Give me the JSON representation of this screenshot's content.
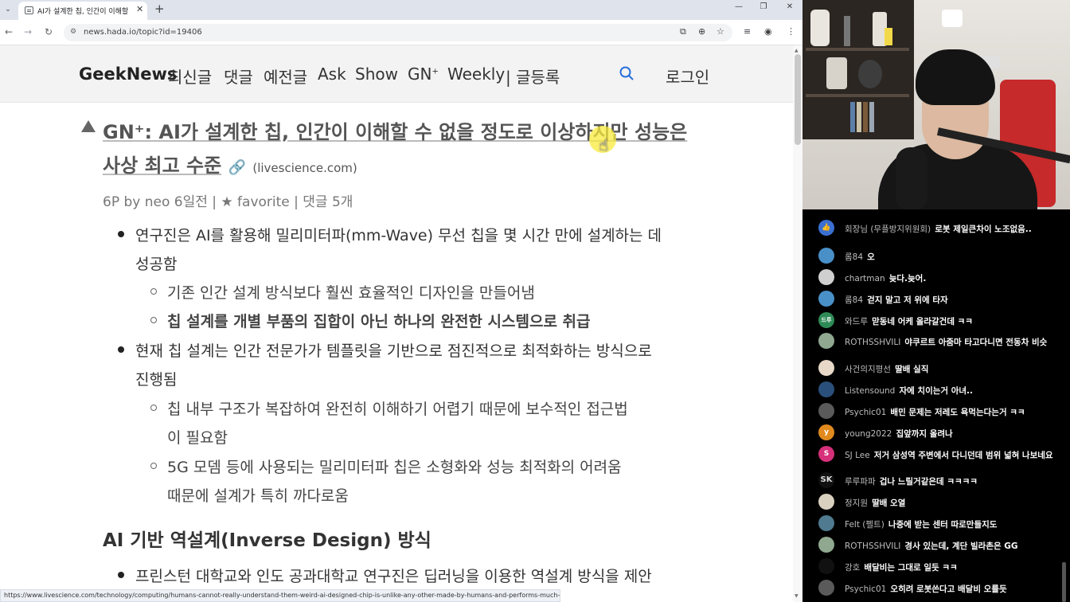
{
  "browser": {
    "tab_title": "AI가 설계한 칩, 인간이 이해할",
    "url": "news.hada.io/topic?id=19406",
    "status_url": "https://www.livescience.com/technology/computing/humans-cannot-really-understand-them-weird-ai-designed-chip-is-unlike-any-other-made-by-humans-and-performs-much-better"
  },
  "site": {
    "brand": "GeekNews",
    "nav": [
      "최신글",
      "댓글",
      "예전글",
      "Ask",
      "Show",
      "GN",
      "Weekly",
      "| 글등록"
    ],
    "nav_gn_sup": "+",
    "login": "로그인"
  },
  "article": {
    "title_line1": "GN⁺: AI가 설계한 칩, 인간이 이해할 수 없을 정도로 이상하지만 성능은",
    "title_line2": "사상 최고 수준",
    "domain": "(livescience.com)",
    "meta": "6P by neo 6일전 | ★ favorite | 댓글 5개",
    "b1_l1": "연구진은 AI를 활용해 밀리미터파(mm-Wave) 무선 칩을 몇 시간 만에 설계하는 데",
    "b1_l2": "성공함",
    "b1_s1": "기존 인간 설계 방식보다 훨씬 효율적인 디자인을 만들어냄",
    "b1_s2": "칩 설계를 개별 부품의 집합이 아닌 하나의 완전한 시스템으로 취급",
    "b2_l1": "현재 칩 설계는 인간 전문가가 템플릿을 기반으로 점진적으로 최적화하는 방식으로",
    "b2_l2": "진행됨",
    "b2_s1_l1": "칩 내부 구조가 복잡하여 완전히 이해하기 어렵기 때문에 보수적인 접근법",
    "b2_s1_l2": "이 필요함",
    "b2_s2_l1": "5G 모뎀 등에 사용되는 밀리미터파 칩은 소형화와 성능 최적화의 어려움",
    "b2_s2_l2": "때문에 설계가 특히 까다로움",
    "h2": "AI 기반 역설계(Inverse Design) 방식",
    "b3_l1": "프린스턴 대학교와 인도 공과대학교 연구진은 딥러닝을 이용한 역설계 방식을 제안"
  },
  "chat": [
    {
      "user": "회장님 (무플방지위원회)",
      "msg": "로봇 제일큰차이 노조없음..",
      "color": "#3b6fd1",
      "avatar": "👍"
    },
    {
      "user": "롬84",
      "msg": "오",
      "color": "#4a90c8",
      "avatar": ""
    },
    {
      "user": "chartman",
      "msg": "늦다.늦어.",
      "color": "#cfcfcf",
      "avatar": ""
    },
    {
      "user": "롬84",
      "msg": "걷지 말고 저 위에 타자",
      "color": "#4a90c8",
      "avatar": ""
    },
    {
      "user": "와드루",
      "msg": "맏동네 어케 올라갈건데 ㅋㅋ",
      "color": "#2e8b57",
      "avatar": "드루"
    },
    {
      "user": "ROTHSSHVILI",
      "msg": "야쿠르트 아줌마 타고다니면 전동차 비슷",
      "color": "#8fa88f",
      "avatar": ""
    },
    {
      "user": "사건의지평선",
      "msg": "딸배 실직",
      "color": "#e8d8c8",
      "avatar": ""
    },
    {
      "user": "Listensound",
      "msg": "자에 치이는거 아녀..",
      "color": "#2a4f7a",
      "avatar": ""
    },
    {
      "user": "Psychic01",
      "msg": "배민 문제는 저레도 욕먹는다는거 ㅋㅋ",
      "color": "#5a5a5a",
      "avatar": ""
    },
    {
      "user": "young2022",
      "msg": "집앞까지 올려나",
      "color": "#e08a1e",
      "avatar": "y"
    },
    {
      "user": "SJ Lee",
      "msg": "저거 삼성역 주변에서 다니던데 범위 넓혀 나보네요",
      "color": "#d6307a",
      "avatar": "S"
    },
    {
      "user": "루루파파",
      "msg": "겁나 느릴거같은데 ㅋㅋㅋㅋ",
      "color": "#111111",
      "avatar": "SK"
    },
    {
      "user": "정지원",
      "msg": "딸배 오열",
      "color": "#d9d0c0",
      "avatar": ""
    },
    {
      "user": "Felt (펠트)",
      "msg": "나중에 받는 센터 따로만들지도",
      "color": "#4f7a8f",
      "avatar": ""
    },
    {
      "user": "ROTHSSHVILI",
      "msg": "경사 있는데, 계단 빌라촌은 GG",
      "color": "#8fa88f",
      "avatar": ""
    },
    {
      "user": "강호",
      "msg": "배달비는 그대로 일듯 ㅋㅋ",
      "color": "#111111",
      "avatar": ""
    },
    {
      "user": "Psychic01",
      "msg": "오히려 로봇쓴다고 배달비 오를듯",
      "color": "#5a5a5a",
      "avatar": ""
    }
  ]
}
